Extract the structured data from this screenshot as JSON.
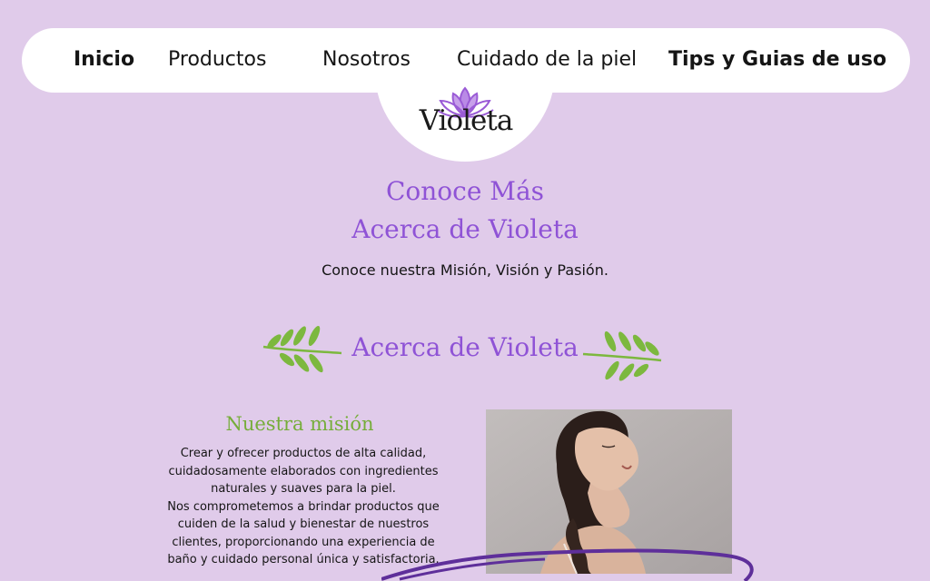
{
  "nav": {
    "items": [
      {
        "label": "Inicio"
      },
      {
        "label": "Productos"
      },
      {
        "label": "Nosotros"
      },
      {
        "label": "Cuidado de la piel"
      },
      {
        "label": "Tips y Guias de uso"
      }
    ]
  },
  "logo": {
    "text": "Violeta",
    "icon": "lotus-icon"
  },
  "hero": {
    "title_line1": "Conoce Más",
    "title_line2": "Acerca de Violeta",
    "subtitle": "Conoce nuestra Misión, Visión y Pasión."
  },
  "about": {
    "heading": "Acerca de Violeta",
    "left_icon": "leaf-branch-icon",
    "right_icon": "leaf-branch-icon"
  },
  "mission": {
    "title": "Nuestra misión",
    "paragraph1": "Crear y ofrecer productos de alta calidad, cuidadosamente elaborados con ingredientes naturales y suaves para la piel.",
    "paragraph2": "Nos comprometemos a brindar productos que cuiden de la salud y bienestar de nuestros clientes, proporcionando una experiencia de baño y cuidado personal única y satisfactoria."
  },
  "colors": {
    "background": "#e0cbea",
    "accent_purple": "#8f53d6",
    "accent_green": "#76ad3a",
    "nav_bg": "#ffffff"
  }
}
